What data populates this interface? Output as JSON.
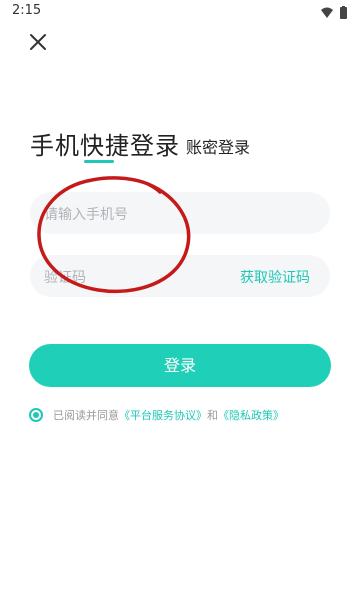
{
  "status": {
    "time": "2:15"
  },
  "icons": {
    "close": "close-icon",
    "wifi": "wifi-icon",
    "battery": "battery-icon"
  },
  "tabs": {
    "quick_login": "手机快捷登录",
    "password_login": "账密登录"
  },
  "phone_field": {
    "placeholder": "请输入手机号",
    "value": ""
  },
  "code_field": {
    "placeholder": "验证码",
    "value": "",
    "get_code": "获取验证码"
  },
  "login_button": "登录",
  "agreement": {
    "prefix": "已阅读并同意",
    "service": "《平台服务协议》",
    "and": "和",
    "privacy": "《隐私政策》",
    "checked": true
  },
  "colors": {
    "accent": "#1ec8b4",
    "button": "#20cfb8",
    "annotation": "#c41a1a"
  }
}
